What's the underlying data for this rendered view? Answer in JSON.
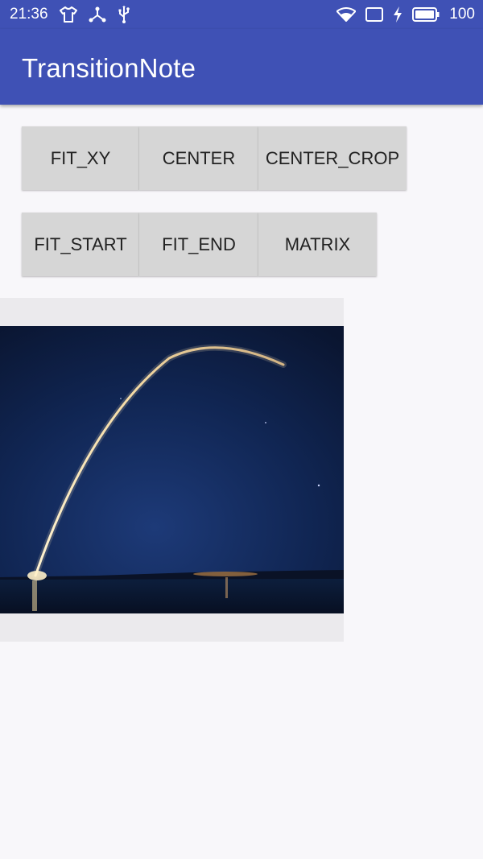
{
  "status_bar": {
    "time": "21:36",
    "battery": "100",
    "left_icons": [
      "tshirt-icon",
      "usb-network-icon",
      "usb-icon"
    ],
    "right_icons": [
      "wifi-icon",
      "screen-cast-icon",
      "charging-icon",
      "battery-icon"
    ]
  },
  "app_bar": {
    "title": "TransitionNote",
    "color": "#3f51b5"
  },
  "buttons_row1": {
    "fit_xy": "FIT_XY",
    "center": "CENTER",
    "center_crop": "CENTER_CROP"
  },
  "buttons_row2": {
    "fit_start": "FIT_START",
    "fit_end": "FIT_END",
    "matrix": "MATRIX"
  },
  "image": {
    "content": "rocket-launch-night-photo"
  }
}
